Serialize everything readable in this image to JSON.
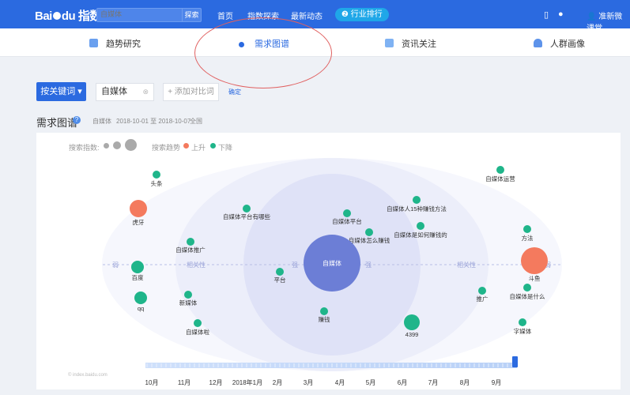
{
  "header": {
    "logo_text": "Bai",
    "logo_text2": "du",
    "logo_sub": "指数",
    "search_placeholder": "自媒体",
    "search_button": "探索",
    "nav": [
      "首页",
      "指数探索",
      "最新动态"
    ],
    "industry_button": "行业排行",
    "user": "准新微课堂"
  },
  "tabs": [
    {
      "label": "趋势研究",
      "active": false
    },
    {
      "label": "需求图谱",
      "active": true
    },
    {
      "label": "资讯关注",
      "active": false
    },
    {
      "label": "人群画像",
      "active": false
    }
  ],
  "controls": {
    "keyword_button": "按关键词",
    "keyword_value": "自媒体",
    "add_compare": "+ 添加对比词",
    "confirm": "确定"
  },
  "section": {
    "title": "需求图谱",
    "keyword": "自媒体",
    "date_range": "2018-10-01 至 2018-10-07",
    "region": "全国"
  },
  "legend": {
    "search_index_label": "搜索指数:",
    "trend_label": "搜索趋势",
    "up_label": "上升",
    "down_label": "下降",
    "up_color": "#f47a5e",
    "down_color": "#1fb58a"
  },
  "graph": {
    "center": "自媒体",
    "axis_labels": [
      "弱",
      "相关性",
      "强",
      "强",
      "相关性",
      "弱"
    ],
    "nodes": [
      {
        "label": "头条",
        "trend": "down"
      },
      {
        "label": "虎牙",
        "trend": "up"
      },
      {
        "label": "自媒体平台有哪些",
        "trend": "down"
      },
      {
        "label": "自媒体推广",
        "trend": "down"
      },
      {
        "label": "百度",
        "trend": "down"
      },
      {
        "label": "qq",
        "trend": "down"
      },
      {
        "label": "新媒体",
        "trend": "down"
      },
      {
        "label": "自媒体啦",
        "trend": "down"
      },
      {
        "label": "平台",
        "trend": "down"
      },
      {
        "label": "自媒体平台",
        "trend": "down"
      },
      {
        "label": "自媒体怎么赚钱",
        "trend": "down"
      },
      {
        "label": "自媒体人15种赚钱方法",
        "trend": "down"
      },
      {
        "label": "自媒体是如何赚钱的",
        "trend": "down"
      },
      {
        "label": "赚钱",
        "trend": "down"
      },
      {
        "label": "4399",
        "trend": "down"
      },
      {
        "label": "自媒体运营",
        "trend": "down"
      },
      {
        "label": "方法",
        "trend": "down"
      },
      {
        "label": "斗鱼",
        "trend": "up"
      },
      {
        "label": "推广",
        "trend": "down"
      },
      {
        "label": "自媒体是什么",
        "trend": "down"
      },
      {
        "label": "字媒体",
        "trend": "down"
      }
    ]
  },
  "timeline": [
    "10月",
    "11月",
    "12月",
    "2018年1月",
    "2月",
    "3月",
    "4月",
    "5月",
    "6月",
    "7月",
    "8月",
    "9月"
  ],
  "watermark": "© index.baidu.com"
}
